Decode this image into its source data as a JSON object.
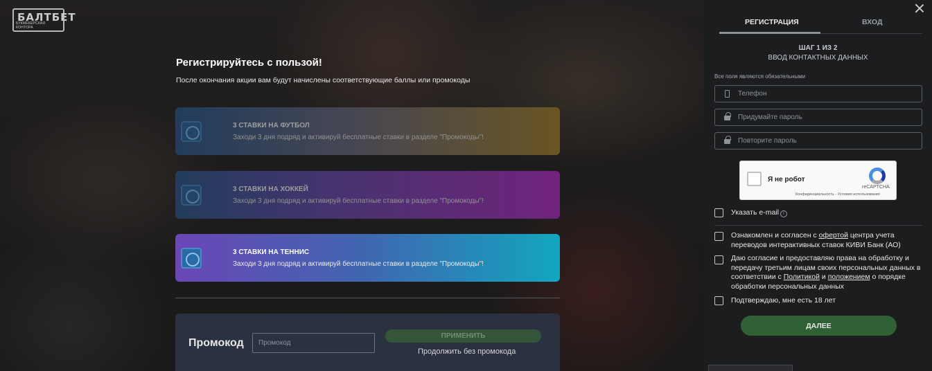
{
  "brand": {
    "logo_word": "БАЛТБЕТ",
    "logo_sub": "БУКМЕКЕРСКАЯ КОНТОРА"
  },
  "hero": {
    "headline": "Регистрируйтесь с пользой!",
    "subline": "После окончания акции вам будут начислены соответствующие баллы или промокоды"
  },
  "promos": [
    {
      "title": "3 СТАВКИ НА ФУТБОЛ",
      "desc": "Заходи 3 дня подряд и активируй бесплатные ставки в разделе \"Промокоды\"!",
      "icon": "ball-icon"
    },
    {
      "title": "3 СТАВКИ НА ХОККЕЙ",
      "desc": "Заходи 3 дня подряд и активируй бесплатные ставки в разделе \"Промокоды\"!",
      "icon": "puck-icon"
    },
    {
      "title": "3 СТАВКИ НА ТЕННИС",
      "desc": "Заходи 3 дня подряд и активируй бесплатные ставки в разделе \"Промокоды\"!",
      "icon": "tennis-icon"
    }
  ],
  "promocode": {
    "label": "Промокод",
    "placeholder": "Промокод",
    "apply": "ПРИМЕНИТЬ",
    "skip": "Продолжить без промокода"
  },
  "panel": {
    "tabs": {
      "register": "РЕГИСТРАЦИЯ",
      "login": "ВХОД"
    },
    "step": "ШАГ 1 ИЗ 2",
    "step_title": "ВВОД КОНТАКТНЫХ ДАННЫХ",
    "required_note": "Все поля являются обязательными",
    "fields": {
      "phone": "Телефон",
      "password": "Придумайте пароль",
      "password_repeat": "Повторите пароль"
    },
    "captcha": {
      "label": "Я не робот",
      "brand": "reCAPTCHA",
      "links": "Конфиденциальность - Условия использования"
    },
    "email_toggle": "Указать e-mail",
    "agree1": {
      "pre": "Ознакомлен и согласен с ",
      "link": "офертой",
      "post": " центра учета переводов интерактивных ставок КИВИ Банк (АО)"
    },
    "agree2": {
      "pre": "Даю согласие и предоставляю права на обработку и передачу третьим лицам своих персональных данных в соответствии с ",
      "link1": "Политикой",
      "mid": " и ",
      "link2": "положением",
      "post": " о порядке обработки персональных данных"
    },
    "age": "Подтверждаю, мне есть 18 лет",
    "next": "ДАЛЕЕ"
  },
  "colors": {
    "panel_bg": "#1c1d1f",
    "next_button": "#2f6134",
    "promocode_box": "#2a3140"
  }
}
